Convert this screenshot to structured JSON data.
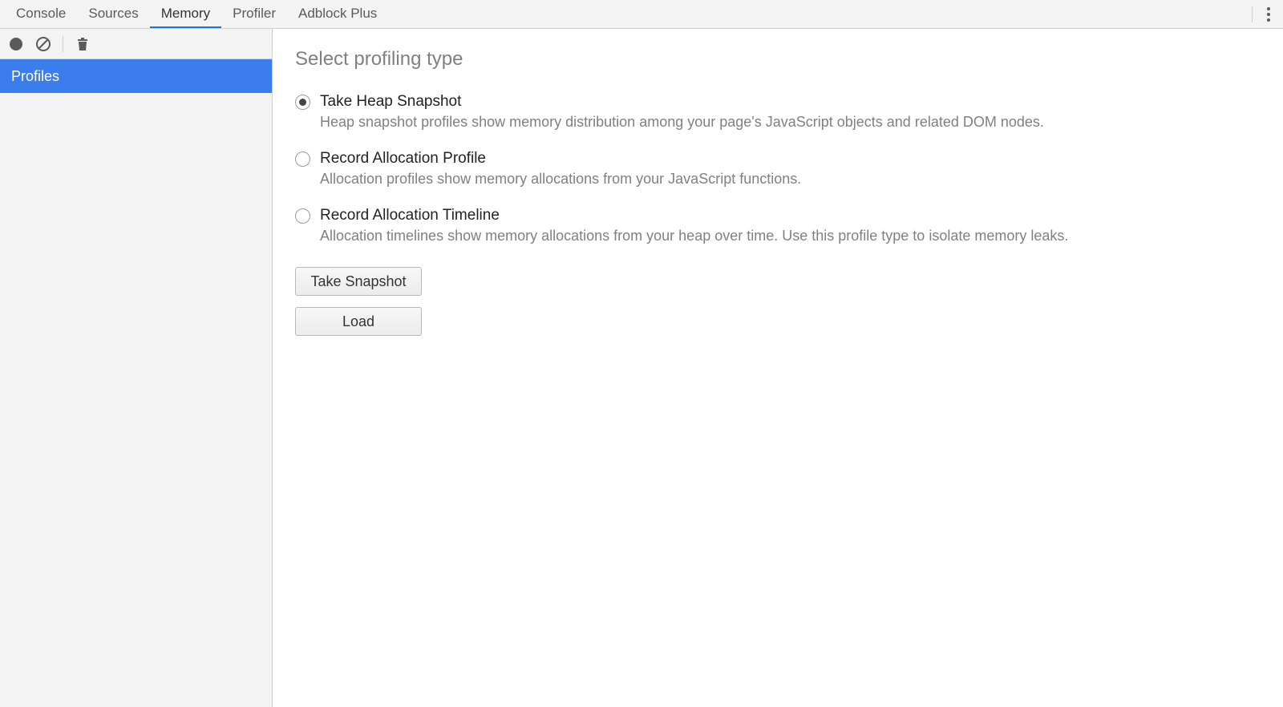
{
  "topbar": {
    "tabs": [
      {
        "label": "Console",
        "active": false
      },
      {
        "label": "Sources",
        "active": false
      },
      {
        "label": "Memory",
        "active": true
      },
      {
        "label": "Profiler",
        "active": false
      },
      {
        "label": "Adblock Plus",
        "active": false
      }
    ]
  },
  "sidebar": {
    "header": "Profiles"
  },
  "main": {
    "title": "Select profiling type",
    "options": [
      {
        "title": "Take Heap Snapshot",
        "desc": "Heap snapshot profiles show memory distribution among your page's JavaScript objects and related DOM nodes.",
        "selected": true
      },
      {
        "title": "Record Allocation Profile",
        "desc": "Allocation profiles show memory allocations from your JavaScript functions.",
        "selected": false
      },
      {
        "title": "Record Allocation Timeline",
        "desc": "Allocation timelines show memory allocations from your heap over time. Use this profile type to isolate memory leaks.",
        "selected": false
      }
    ],
    "buttons": {
      "take_snapshot": "Take Snapshot",
      "load": "Load"
    }
  }
}
